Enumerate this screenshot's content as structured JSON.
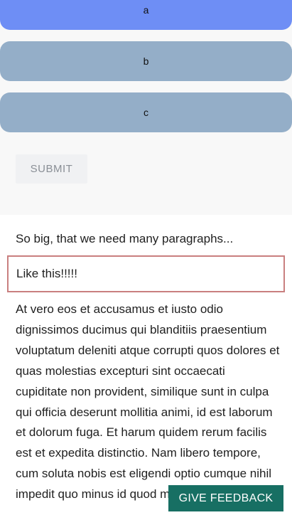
{
  "quiz": {
    "options": [
      {
        "label": "a",
        "selected": true
      },
      {
        "label": "b",
        "selected": false
      },
      {
        "label": "c",
        "selected": false
      }
    ],
    "submit_label": "SUBMIT"
  },
  "content": {
    "intro": "So big, that we need many paragraphs...",
    "quote": "Like this!!!!!",
    "body": "At vero eos et accusamus et iusto odio dignissimos ducimus qui blanditiis praesentium voluptatum deleniti atque corrupti quos dolores et quas molestias excepturi sint occaecati cupiditate non provident, similique sunt in culpa qui officia deserunt mollitia animi, id est laborum et dolorum fuga. Et harum quidem rerum facilis est et expedita distinctio. Nam libero tempore, cum soluta nobis est eligendi optio cumque nihil impedit quo minus id quod maxime"
  },
  "feedback_label": "GIVE FEEDBACK",
  "colors": {
    "selected_option": "#6e8ef5",
    "option": "#94aec8",
    "feedback_bg": "#176f63",
    "quote_border": "#c97f7f"
  }
}
